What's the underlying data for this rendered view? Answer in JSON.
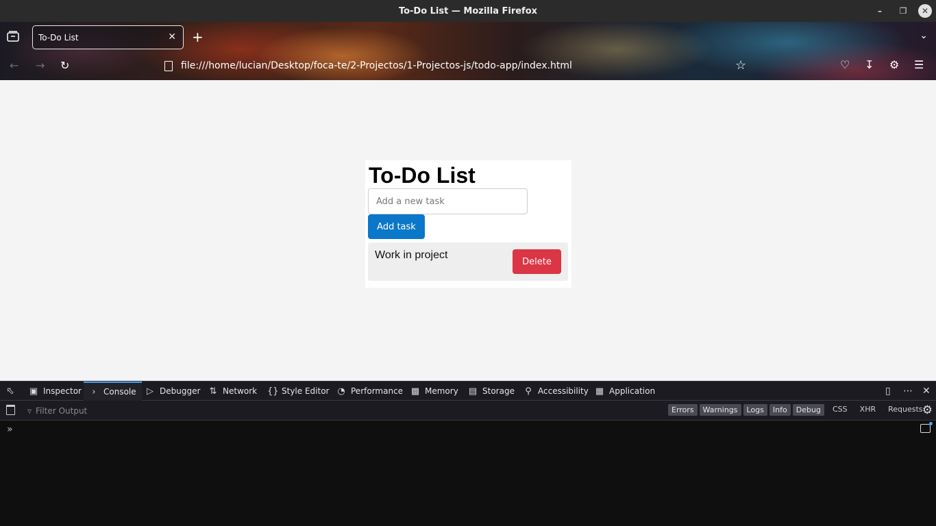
{
  "window": {
    "title": "To-Do List — Mozilla Firefox",
    "min_icon": "minimize-icon",
    "max_icon": "maximize-icon",
    "close_icon": "close-icon"
  },
  "browser": {
    "tab_title": "To-Do List",
    "url": "file:///home/lucian/Desktop/foca-te/2-Projectos/1-Projectos-js/todo-app/index.html"
  },
  "page": {
    "title": "To-Do List",
    "input_placeholder": "Add a new task",
    "add_button": "Add task",
    "tasks": [
      {
        "text": "Work in project",
        "delete_label": "Delete"
      }
    ],
    "colors": {
      "add_button": "#0a77c9",
      "delete_button": "#dc3545"
    }
  },
  "devtools": {
    "tabs": [
      {
        "label": "Inspector"
      },
      {
        "label": "Console"
      },
      {
        "label": "Debugger"
      },
      {
        "label": "Network"
      },
      {
        "label": "Style Editor"
      },
      {
        "label": "Performance"
      },
      {
        "label": "Memory"
      },
      {
        "label": "Storage"
      },
      {
        "label": "Accessibility"
      },
      {
        "label": "Application"
      }
    ],
    "active_tab": "Console",
    "filter_placeholder": "Filter Output",
    "levels": [
      "Errors",
      "Warnings",
      "Logs",
      "Info",
      "Debug"
    ],
    "extra_filters": [
      "CSS",
      "XHR",
      "Requests"
    ]
  }
}
